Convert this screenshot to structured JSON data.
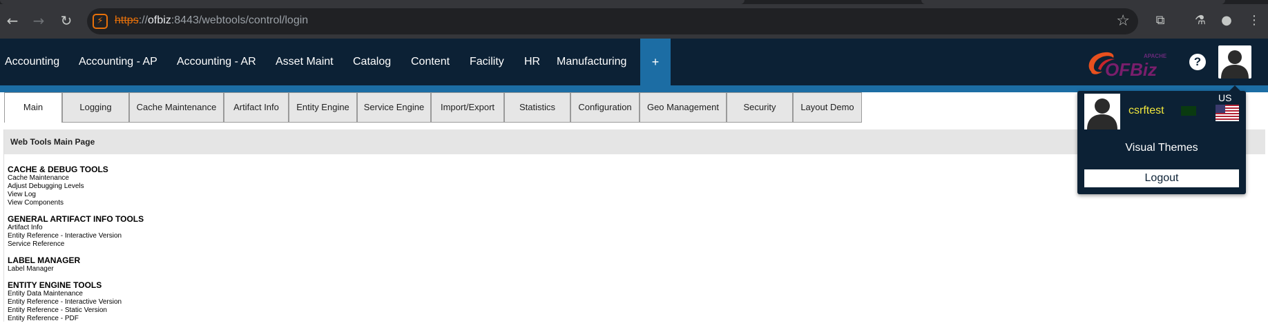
{
  "browser": {
    "url_protocol": "https",
    "url_separator": "://",
    "url_host": "ofbiz",
    "url_rest": ":8443/webtools/control/login",
    "back_icon": "arrow-left-icon",
    "forward_icon": "arrow-right-icon",
    "reload_icon": "reload-icon",
    "star_icon": "star-icon"
  },
  "app_menu": {
    "items": [
      "Accounting",
      "Accounting - AP",
      "Accounting - AR",
      "Asset Maint",
      "Catalog",
      "Content",
      "Facility",
      "HR",
      "Manufacturing"
    ],
    "plus_label": "+",
    "logo_text": "OFBiz",
    "logo_small": "APACHE",
    "help_label": "?"
  },
  "tabs": {
    "items": [
      "Main",
      "Logging",
      "Cache Maintenance",
      "Artifact Info",
      "Entity Engine",
      "Service Engine",
      "Import/Export",
      "Statistics",
      "Configuration",
      "Geo Management",
      "Security",
      "Layout Demo"
    ],
    "active": "Main"
  },
  "main": {
    "title": "Web Tools Main Page",
    "sections": [
      {
        "heading": "CACHE & DEBUG TOOLS",
        "links": [
          "Cache Maintenance",
          "Adjust Debugging Levels",
          "View Log",
          "View Components"
        ]
      },
      {
        "heading": "GENERAL ARTIFACT INFO TOOLS",
        "links": [
          "Artifact Info",
          "Entity Reference - Interactive Version",
          "Service Reference"
        ]
      },
      {
        "heading": "LABEL MANAGER",
        "links": [
          "Label Manager"
        ]
      },
      {
        "heading": "ENTITY ENGINE TOOLS",
        "links": [
          "Entity Data Maintenance",
          "Entity Reference - Interactive Version",
          "Entity Reference - Static Version",
          "Entity Reference - PDF"
        ]
      }
    ]
  },
  "user_panel": {
    "username": "csrftest",
    "locale": "US",
    "visual_themes": "Visual Themes",
    "logout": "Logout"
  },
  "colors": {
    "app_bar": "#0c2135",
    "accent_blue": "#1c6da4",
    "username": "#f0e63c"
  }
}
